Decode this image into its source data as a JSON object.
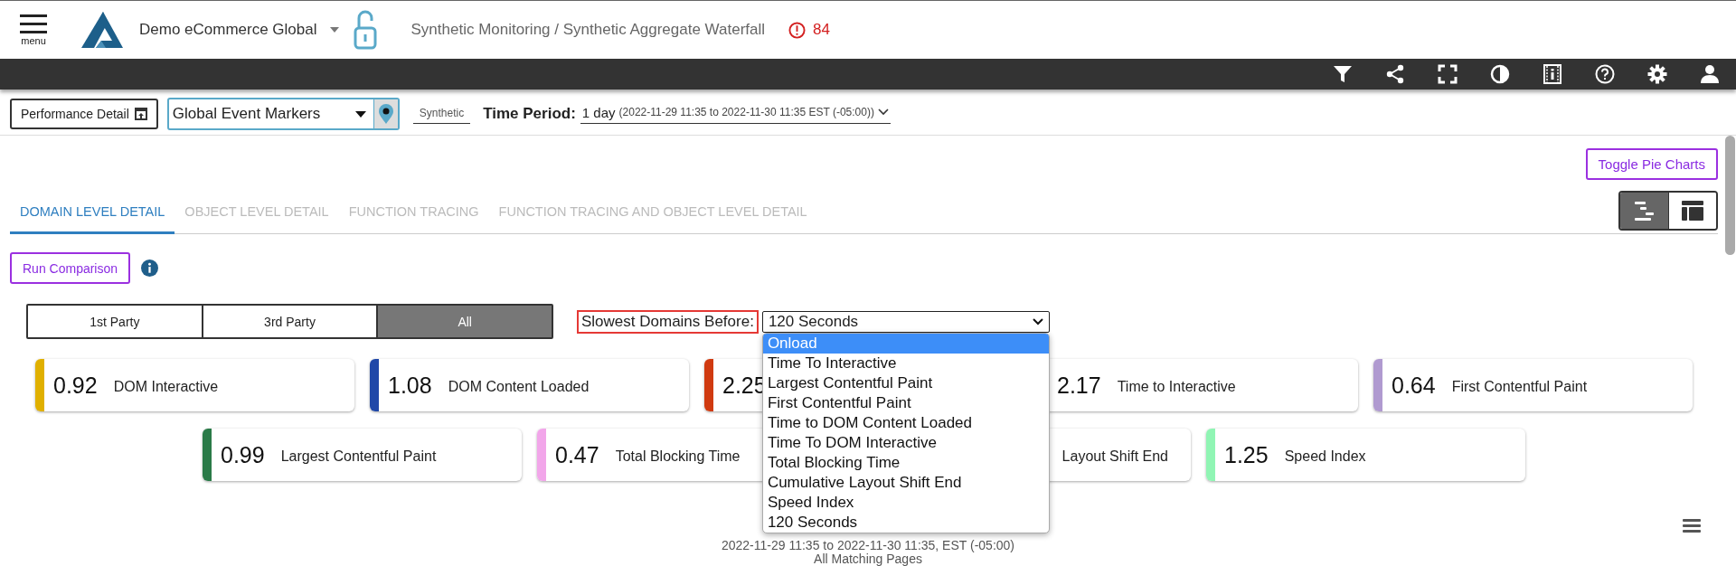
{
  "header": {
    "menu_label": "menu",
    "org": "Demo eCommerce Global",
    "breadcrumb": "Synthetic Monitoring / Synthetic Aggregate Waterfall",
    "alert_count": "84"
  },
  "filters": {
    "performance_button": "Performance Detail",
    "event_markers": "Global Event Markers",
    "source_tag": "Synthetic",
    "time_period_label": "Time Period:",
    "time_period_value": "1 day",
    "time_period_range": "(2022-11-29 11:35 to 2022-11-30 11:35 EST (-05:00))"
  },
  "toggle_pie_charts": "Toggle Pie Charts",
  "tabs": [
    {
      "label": "DOMAIN LEVEL DETAIL",
      "selected": true
    },
    {
      "label": "OBJECT LEVEL DETAIL",
      "selected": false
    },
    {
      "label": "FUNCTION TRACING",
      "selected": false
    },
    {
      "label": "FUNCTION TRACING AND OBJECT LEVEL DETAIL",
      "selected": false
    }
  ],
  "view_toggles": [
    {
      "kind": "waterfall",
      "selected": true
    },
    {
      "kind": "layout",
      "selected": false
    }
  ],
  "run_comparison": "Run Comparison",
  "party_filter": [
    {
      "label": "1st Party",
      "selected": false
    },
    {
      "label": "3rd Party",
      "selected": false
    },
    {
      "label": "All",
      "selected": true
    }
  ],
  "slowest_domains": {
    "label": "Slowest Domains Before:",
    "value": "120 Seconds",
    "expanded": true,
    "options": [
      {
        "label": "Onload",
        "highlighted": true
      },
      {
        "label": "Time To Interactive",
        "highlighted": false
      },
      {
        "label": "Largest Contentful Paint",
        "highlighted": false
      },
      {
        "label": "First Contentful Paint",
        "highlighted": false
      },
      {
        "label": "Time to DOM Content Loaded",
        "highlighted": false
      },
      {
        "label": "Time To DOM Interactive",
        "highlighted": false
      },
      {
        "label": "Total Blocking Time",
        "highlighted": false
      },
      {
        "label": "Cumulative Layout Shift End",
        "highlighted": false
      },
      {
        "label": "Speed Index",
        "highlighted": false
      },
      {
        "label": "120 Seconds",
        "highlighted": false
      }
    ]
  },
  "metric_rows": [
    {
      "cards": [
        {
          "value": "0.92",
          "label": "DOM Interactive",
          "color": "#e0b000"
        },
        {
          "value": "1.08",
          "label": "DOM Content Loaded",
          "color": "#2048a8"
        },
        {
          "value": "2.25",
          "color": "#d03a10"
        },
        {
          "value": "2.17",
          "label": "Time to Interactive"
        },
        {
          "value": "0.64",
          "label": "First Contentful Paint",
          "color": "#b09ad0"
        }
      ]
    },
    {
      "cards": [
        {
          "value": "0.99",
          "label": "Largest Contentful Paint",
          "color": "#2a7a48"
        },
        {
          "value": "0.47",
          "label": "Total Blocking Time",
          "color": "#f2a6ea"
        },
        {
          "label": "Layout Shift End"
        },
        {
          "value": "1.25",
          "label": "Speed Index",
          "color": "#90f5b4"
        }
      ]
    }
  ],
  "footer": {
    "range": "2022-11-29 11:35 to 2022-11-30 11:35, EST (-05:00)",
    "pages": "All Matching Pages"
  }
}
